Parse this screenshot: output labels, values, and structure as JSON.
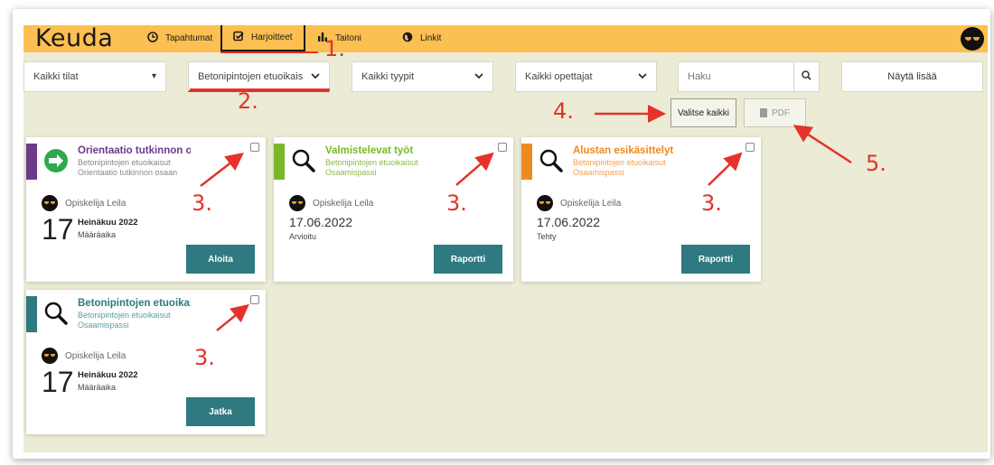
{
  "header": {
    "logo": "Keuda",
    "nav": [
      {
        "label": "Tapahtumat",
        "icon": "clock-icon"
      },
      {
        "label": "Harjoitteet",
        "icon": "checkbox-icon"
      },
      {
        "label": "Taitoni",
        "icon": "bar-chart-icon"
      },
      {
        "label": "Linkit",
        "icon": "globe-icon"
      }
    ]
  },
  "filters": {
    "status": "Kaikki tilat",
    "subject": "Betonipintojen etuoikais",
    "type": "Kaikki tyypit",
    "teacher": "Kaikki opettajat",
    "search_placeholder": "Haku",
    "show_more": "Näytä lisää"
  },
  "actions": {
    "select_all": "Valitse kaikki",
    "pdf": "PDF"
  },
  "colors": {
    "header": "#fcbf52",
    "background": "#ebebd6",
    "teal": "#2e7a80",
    "purple": "#6a3a8b",
    "green": "#7ab82b",
    "orange": "#ef8a21",
    "annotation": "#e5322a"
  },
  "cards": [
    {
      "title": "Orientaatio tutkinnon o",
      "sub1": "Betonipintojen etuoikaisut",
      "sub2": "Orientaatio tutkinnon osaan",
      "student": "Opiskelija Leila",
      "day": "17",
      "month": "Heinäkuu 2022",
      "due_label": "Määräaika",
      "button": "Aloita"
    },
    {
      "title": "Valmistelevat työt",
      "sub1": "Betonipintojen etuoikaisut",
      "sub2": "Osaamispassi",
      "student": "Opiskelija Leila",
      "date": "17.06.2022",
      "status": "Arvioitu",
      "button": "Raportti"
    },
    {
      "title": "Alustan esikäsittelyt",
      "sub1": "Betonipintojen etuoikaisut",
      "sub2": "Osaamispassi",
      "student": "Opiskelija Leila",
      "date": "17.06.2022",
      "status": "Tehty",
      "button": "Raportti"
    },
    {
      "title": "Betonipintojen etuoikai:",
      "sub1": "Betonipintojen etuoikaisut",
      "sub2": "Osaamispassi",
      "student": "Opiskelija Leila",
      "day": "17",
      "month": "Heinäkuu 2022",
      "due_label": "Määräaika",
      "button": "Jatka"
    }
  ],
  "annotations": [
    "1.",
    "2.",
    "3.",
    "4.",
    "5."
  ]
}
